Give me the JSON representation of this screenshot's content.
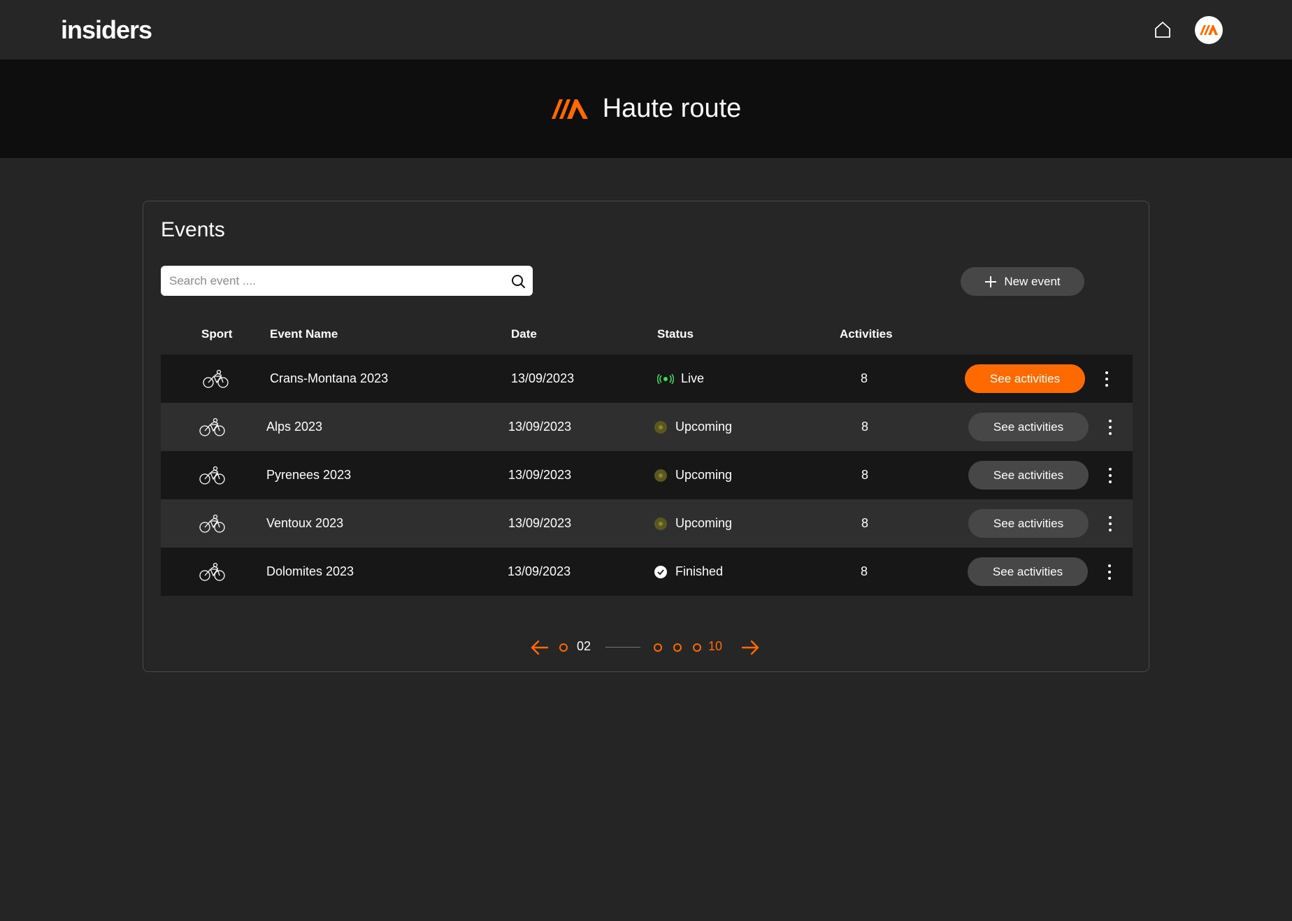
{
  "header": {
    "logo_text": "insiders",
    "home_icon": "home-icon",
    "avatar_icon": "brand-mark-icon"
  },
  "hero": {
    "title": "Haute route"
  },
  "events": {
    "title": "Events",
    "search": {
      "placeholder": "Search event ....",
      "value": ""
    },
    "new_event_label": "New event",
    "columns": {
      "sport": "Sport",
      "event_name": "Event Name",
      "date": "Date",
      "status": "Status",
      "activities": "Activities"
    },
    "rows": [
      {
        "sport": "cycling",
        "name": "Crans-Montana 2023",
        "date": "13/09/2023",
        "status": "Live",
        "activities": "8",
        "action": "See activities"
      },
      {
        "sport": "cycling",
        "name": "Alps 2023",
        "date": "13/09/2023",
        "status": "Upcoming",
        "activities": "8",
        "action": "See activities"
      },
      {
        "sport": "cycling",
        "name": "Pyrenees 2023",
        "date": "13/09/2023",
        "status": "Upcoming",
        "activities": "8",
        "action": "See activities"
      },
      {
        "sport": "cycling",
        "name": "Ventoux 2023",
        "date": "13/09/2023",
        "status": "Upcoming",
        "activities": "8",
        "action": "See activities"
      },
      {
        "sport": "cycling",
        "name": "Dolomites 2023",
        "date": "13/09/2023",
        "status": "Finished",
        "activities": "8",
        "action": "See activities"
      }
    ]
  },
  "pagination": {
    "current": "02",
    "last": "10"
  },
  "colors": {
    "accent": "#ff6a00",
    "live": "#3ddc5c",
    "upcoming": "#8b8630"
  }
}
